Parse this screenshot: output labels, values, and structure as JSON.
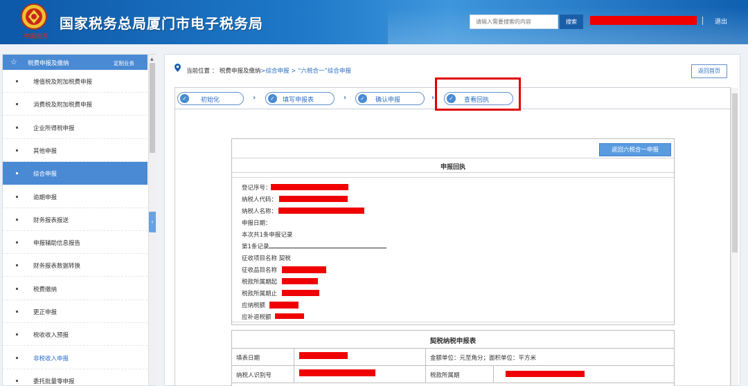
{
  "header": {
    "emblem_text": "中国税务",
    "title": "国家税务总局厦门市电子税务局",
    "search_placeholder": "请输入需要搜索的内容",
    "search_label": "搜索",
    "logout_label": "退出"
  },
  "sidebar": {
    "heading": "税费申报及缴纳",
    "custom_label": "定制业务",
    "items": [
      {
        "label": "增值税及附加税费申报"
      },
      {
        "label": "消费税及附加税费申报"
      },
      {
        "label": "企业所得税申报"
      },
      {
        "label": "其他申报"
      },
      {
        "label": "综合申报"
      },
      {
        "label": "逾期申报"
      },
      {
        "label": "财务报表报送"
      },
      {
        "label": "申报辅助信息报告"
      },
      {
        "label": "财务报表数据转换"
      },
      {
        "label": "税费缴纳"
      },
      {
        "label": "更正申报"
      },
      {
        "label": "税收收入预报"
      },
      {
        "label": "非税收入申报"
      },
      {
        "label": "委托批量零申报"
      }
    ],
    "active_index": 4
  },
  "breadcrumb": {
    "prefix": "当前位置 ：",
    "level1": "税费申报及缴纳",
    "level2": ">综合申报 >",
    "level3": "“六税合一”综合申报"
  },
  "home_button": "返回首页",
  "steps": [
    {
      "label": "初始化"
    },
    {
      "label": "填写申报表"
    },
    {
      "label": "确认申报"
    },
    {
      "label": "查看回执"
    }
  ],
  "receipt": {
    "back_button": "返回六税合一申报",
    "title": "申报回执",
    "fields": [
      {
        "label": "登记序号："
      },
      {
        "label": "纳税人代码："
      },
      {
        "label": "纳税人名称："
      },
      {
        "label": "申报日期："
      },
      {
        "label": "本次共1条申报记录"
      },
      {
        "label": "第1条记录"
      },
      {
        "label": "征收项目名称 契税"
      },
      {
        "label": "征收品目名称"
      },
      {
        "label": "税款所属期起"
      },
      {
        "label": "税款所属期止"
      },
      {
        "label": "应纳税额"
      },
      {
        "label": "应补退税额"
      }
    ]
  },
  "declaration": {
    "title": "契税纳税申报表",
    "fill_date_label": "填表日期",
    "unit_label": "金额单位：元至角分；面积单位：平方米",
    "taxpayer_id_label": "纳税人识别号",
    "tax_period_label": "税款所属期"
  },
  "colors": {
    "accent": "#4a8ad4",
    "link": "#2a6ec4",
    "redaction": "#f00000",
    "highlight": "#e00000"
  }
}
